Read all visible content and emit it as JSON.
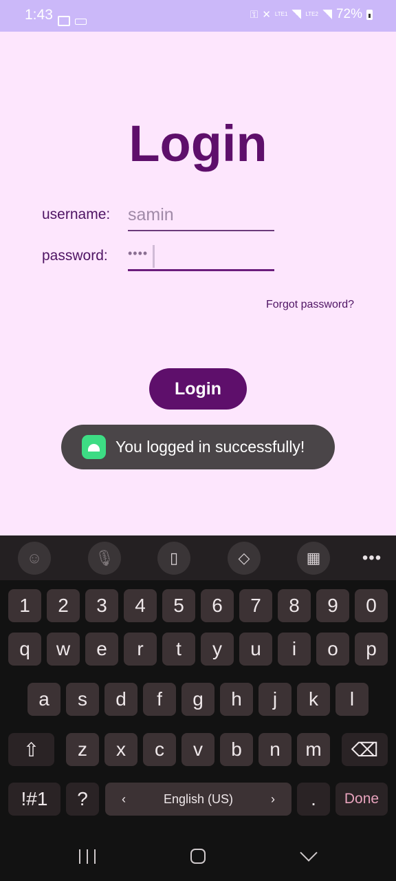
{
  "status_bar": {
    "time": "1:43",
    "battery": "72%",
    "sim1": "LTE1",
    "sim2": "LTE2",
    "icons": [
      "image-icon",
      "keyboard-icon",
      "lock-icon",
      "mute-icon",
      "signal-icon",
      "battery-icon"
    ]
  },
  "app": {
    "title": "Login",
    "username_label": "username:",
    "username_placeholder": "samin",
    "password_label": "password:",
    "password_value": "••••",
    "forgot_link": "Forgot password?",
    "login_button": "Login",
    "accent_color": "#5e0f6b",
    "background_color": "#fde6fd"
  },
  "toast": {
    "message": "You logged in successfully!",
    "icon": "android-icon"
  },
  "keyboard": {
    "toolbar": [
      "emoji-icon",
      "mic-icon",
      "clipboard-icon",
      "cursor-move-icon",
      "numpad-icon",
      "more-icon"
    ],
    "more_label": "•••",
    "row1": [
      "1",
      "2",
      "3",
      "4",
      "5",
      "6",
      "7",
      "8",
      "9",
      "0"
    ],
    "row2": [
      "q",
      "w",
      "e",
      "r",
      "t",
      "y",
      "u",
      "i",
      "o",
      "p"
    ],
    "row3": [
      "a",
      "s",
      "d",
      "f",
      "g",
      "h",
      "j",
      "k",
      "l"
    ],
    "row4": [
      "z",
      "x",
      "c",
      "v",
      "b",
      "n",
      "m"
    ],
    "symbols_key": "!#1",
    "question_key": "?",
    "space_label": "English (US)",
    "period_key": ".",
    "done_key": "Done",
    "left_arrow": "‹",
    "right_arrow": "›"
  },
  "nav_bar": {
    "icons": [
      "recents-icon",
      "home-icon",
      "back-icon"
    ]
  }
}
